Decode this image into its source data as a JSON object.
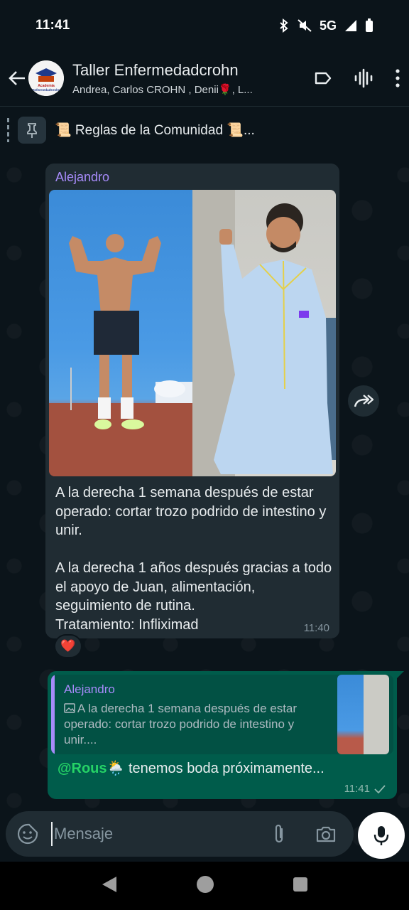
{
  "status": {
    "time": "11:41",
    "network": "5G",
    "icons": [
      "bluetooth-icon",
      "mute-icon",
      "signal-icon",
      "battery-icon"
    ]
  },
  "header": {
    "title": "Taller Enfermedadcrohn",
    "subtitle": "Andrea, Carlos CROHN , Denii🌹, L...",
    "avatar_text": "Academia EnfermedadCrohn"
  },
  "pinned": {
    "text": "📜 Reglas de la Comunidad 📜..."
  },
  "incoming": {
    "sender": "Alejandro",
    "text": "A la derecha 1 semana después de estar operado: cortar trozo podrido de intestino y unir.\n\nA la derecha 1 años después gracias a todo el apoyo de Juan, alimentación, seguimiento de rutina.\nTratamiento: Infliximad",
    "time": "11:40",
    "reaction": "❤️"
  },
  "outgoing": {
    "quote_sender": "Alejandro",
    "quote_text": "A la derecha 1 semana después de estar operado: cortar trozo podrido de intestino y unir....",
    "mention": "@Rous🌦️",
    "text": " tenemos boda próximamente...",
    "time": "11:41"
  },
  "composer": {
    "placeholder": "Mensaje"
  },
  "colors": {
    "background": "#0b141a",
    "incoming_bubble": "#202c33",
    "outgoing_bubble": "#005c4b",
    "sender_name": "#a78bfa",
    "mention": "#25d366"
  }
}
